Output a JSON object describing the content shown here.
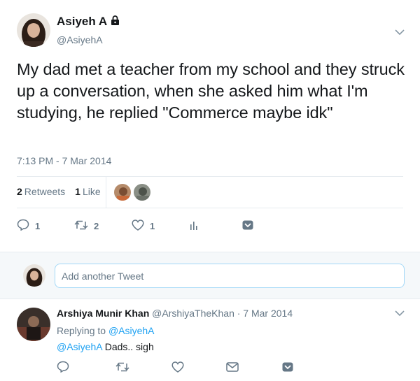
{
  "tweet": {
    "author_name": "Asiyeh A",
    "author_handle": "@AsiyehA",
    "locked_icon": "lock-icon",
    "text": "My dad met a teacher from my school and they struck up a conversation, when she asked him what I'm studying, he replied \"Commerce maybe idk\"",
    "timestamp": "7:13 PM - 7 Mar 2014",
    "retweets_count": "2",
    "retweets_label": "Retweets",
    "likes_count": "1",
    "likes_label": "Like",
    "actions": {
      "reply_count": "1",
      "retweet_count": "2",
      "like_count": "1"
    }
  },
  "composer": {
    "placeholder": "Add another Tweet"
  },
  "reply": {
    "author_name": "Arshiya Munir Khan",
    "author_handle": "@ArshiyaTheKhan",
    "date": "· 7 Mar 2014",
    "replying_to_label": "Replying to",
    "replying_to_handle": "@AsiyehA",
    "mention": "@AsiyehA",
    "text": "Dads.. sigh"
  },
  "colors": {
    "accent": "#1da1f2",
    "secondary_text": "#657786",
    "divider": "#e6ecf0"
  }
}
